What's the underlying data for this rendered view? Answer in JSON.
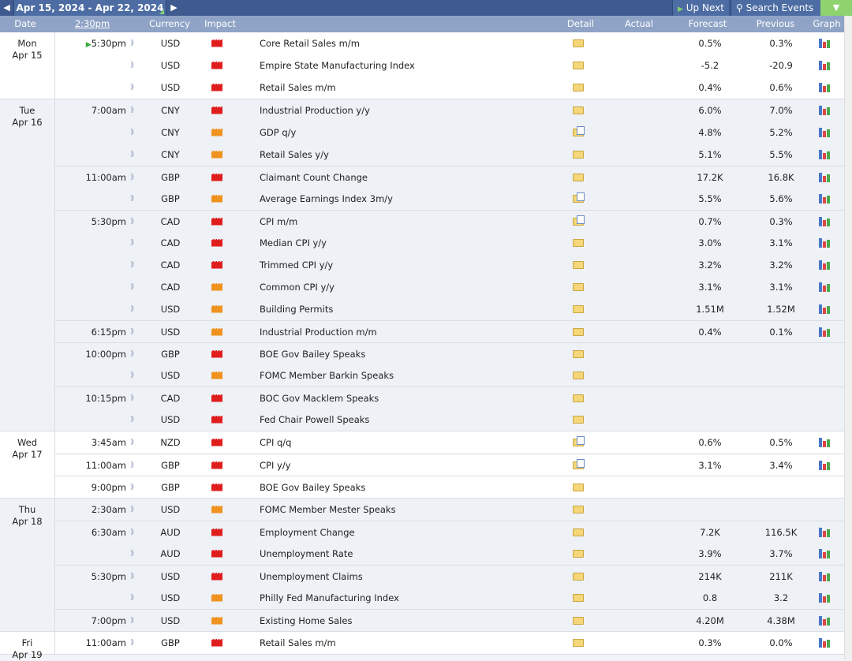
{
  "toolbar": {
    "date_range": "Apr 15, 2024 - Apr 22, 2024",
    "up_next": "Up Next",
    "search_events": "Search Events"
  },
  "columns": {
    "date": "Date",
    "time": "2:30pm",
    "currency": "Currency",
    "impact": "Impact",
    "detail": "Detail",
    "actual": "Actual",
    "forecast": "Forecast",
    "previous": "Previous",
    "graph": "Graph"
  },
  "colors": {
    "high_impact": "#e01d1d",
    "medium_impact": "#f0921e",
    "header": "#8fa3c6",
    "toolbar": "#3e5a8e"
  },
  "days": [
    {
      "day": "Mon",
      "date": "Apr 15",
      "events": [
        {
          "time": "5:30pm",
          "current": true,
          "currency": "USD",
          "impact": "high",
          "title": "Core Retail Sales m/m",
          "detail": "folder",
          "forecast": "0.5%",
          "previous": "0.3%",
          "graph": true
        },
        {
          "time": "",
          "currency": "USD",
          "impact": "high",
          "title": "Empire State Manufacturing Index",
          "detail": "folder",
          "forecast": "-5.2",
          "previous": "-20.9",
          "graph": true
        },
        {
          "time": "",
          "currency": "USD",
          "impact": "high",
          "title": "Retail Sales m/m",
          "detail": "folder",
          "forecast": "0.4%",
          "previous": "0.6%",
          "graph": true
        }
      ]
    },
    {
      "day": "Tue",
      "date": "Apr 16",
      "events": [
        {
          "time": "7:00am",
          "currency": "CNY",
          "impact": "high",
          "title": "Industrial Production y/y",
          "detail": "folder",
          "forecast": "6.0%",
          "previous": "7.0%",
          "graph": true
        },
        {
          "time": "",
          "currency": "CNY",
          "impact": "medium",
          "title": "GDP q/y",
          "detail": "doc",
          "forecast": "4.8%",
          "previous": "5.2%",
          "graph": true
        },
        {
          "time": "",
          "currency": "CNY",
          "impact": "medium",
          "title": "Retail Sales y/y",
          "detail": "folder",
          "forecast": "5.1%",
          "previous": "5.5%",
          "graph": true
        },
        {
          "time": "11:00am",
          "currency": "GBP",
          "impact": "high",
          "title": "Claimant Count Change",
          "detail": "folder",
          "forecast": "17.2K",
          "previous": "16.8K",
          "graph": true,
          "sep": true
        },
        {
          "time": "",
          "currency": "GBP",
          "impact": "medium",
          "title": "Average Earnings Index 3m/y",
          "detail": "doc",
          "forecast": "5.5%",
          "previous": "5.6%",
          "graph": true
        },
        {
          "time": "5:30pm",
          "currency": "CAD",
          "impact": "high",
          "title": "CPI m/m",
          "detail": "doc",
          "forecast": "0.7%",
          "previous": "0.3%",
          "graph": true,
          "sep": true
        },
        {
          "time": "",
          "currency": "CAD",
          "impact": "high",
          "title": "Median CPI y/y",
          "detail": "folder",
          "forecast": "3.0%",
          "previous": "3.1%",
          "graph": true
        },
        {
          "time": "",
          "currency": "CAD",
          "impact": "high",
          "title": "Trimmed CPI y/y",
          "detail": "folder",
          "forecast": "3.2%",
          "previous": "3.2%",
          "graph": true
        },
        {
          "time": "",
          "currency": "CAD",
          "impact": "medium",
          "title": "Common CPI y/y",
          "detail": "folder",
          "forecast": "3.1%",
          "previous": "3.1%",
          "graph": true
        },
        {
          "time": "",
          "currency": "USD",
          "impact": "medium",
          "title": "Building Permits",
          "detail": "folder",
          "forecast": "1.51M",
          "previous": "1.52M",
          "graph": true
        },
        {
          "time": "6:15pm",
          "currency": "USD",
          "impact": "medium",
          "title": "Industrial Production m/m",
          "detail": "folder",
          "forecast": "0.4%",
          "previous": "0.1%",
          "graph": true,
          "sep": true
        },
        {
          "time": "10:00pm",
          "currency": "GBP",
          "impact": "high",
          "title": "BOE Gov Bailey Speaks",
          "detail": "folder",
          "forecast": "",
          "previous": "",
          "graph": false,
          "sep": true
        },
        {
          "time": "",
          "currency": "USD",
          "impact": "medium",
          "title": "FOMC Member Barkin Speaks",
          "detail": "folder",
          "forecast": "",
          "previous": "",
          "graph": false
        },
        {
          "time": "10:15pm",
          "currency": "CAD",
          "impact": "high",
          "title": "BOC Gov Macklem Speaks",
          "detail": "folder",
          "forecast": "",
          "previous": "",
          "graph": false,
          "sep": true
        },
        {
          "time": "",
          "currency": "USD",
          "impact": "high",
          "title": "Fed Chair Powell Speaks",
          "detail": "folder",
          "forecast": "",
          "previous": "",
          "graph": false
        }
      ]
    },
    {
      "day": "Wed",
      "date": "Apr 17",
      "events": [
        {
          "time": "3:45am",
          "currency": "NZD",
          "impact": "high",
          "title": "CPI q/q",
          "detail": "doc",
          "forecast": "0.6%",
          "previous": "0.5%",
          "graph": true
        },
        {
          "time": "11:00am",
          "currency": "GBP",
          "impact": "high",
          "title": "CPI y/y",
          "detail": "doc",
          "forecast": "3.1%",
          "previous": "3.4%",
          "graph": true,
          "sep": true
        },
        {
          "time": "9:00pm",
          "currency": "GBP",
          "impact": "high",
          "title": "BOE Gov Bailey Speaks",
          "detail": "folder",
          "forecast": "",
          "previous": "",
          "graph": false,
          "sep": true
        }
      ]
    },
    {
      "day": "Thu",
      "date": "Apr 18",
      "events": [
        {
          "time": "2:30am",
          "currency": "USD",
          "impact": "medium",
          "title": "FOMC Member Mester Speaks",
          "detail": "folder",
          "forecast": "",
          "previous": "",
          "graph": false
        },
        {
          "time": "6:30am",
          "currency": "AUD",
          "impact": "high",
          "title": "Employment Change",
          "detail": "folder",
          "forecast": "7.2K",
          "previous": "116.5K",
          "graph": true,
          "sep": true
        },
        {
          "time": "",
          "currency": "AUD",
          "impact": "high",
          "title": "Unemployment Rate",
          "detail": "folder",
          "forecast": "3.9%",
          "previous": "3.7%",
          "graph": true
        },
        {
          "time": "5:30pm",
          "currency": "USD",
          "impact": "high",
          "title": "Unemployment Claims",
          "detail": "folder",
          "forecast": "214K",
          "previous": "211K",
          "graph": true,
          "sep": true
        },
        {
          "time": "",
          "currency": "USD",
          "impact": "medium",
          "title": "Philly Fed Manufacturing Index",
          "detail": "folder",
          "forecast": "0.8",
          "previous": "3.2",
          "graph": true
        },
        {
          "time": "7:00pm",
          "currency": "USD",
          "impact": "medium",
          "title": "Existing Home Sales",
          "detail": "folder",
          "forecast": "4.20M",
          "previous": "4.38M",
          "graph": true,
          "sep": true
        }
      ]
    },
    {
      "day": "Fri",
      "date": "Apr 19",
      "events": [
        {
          "time": "11:00am",
          "currency": "GBP",
          "impact": "high",
          "title": "Retail Sales m/m",
          "detail": "folder",
          "forecast": "0.3%",
          "previous": "0.0%",
          "graph": true
        }
      ]
    }
  ]
}
